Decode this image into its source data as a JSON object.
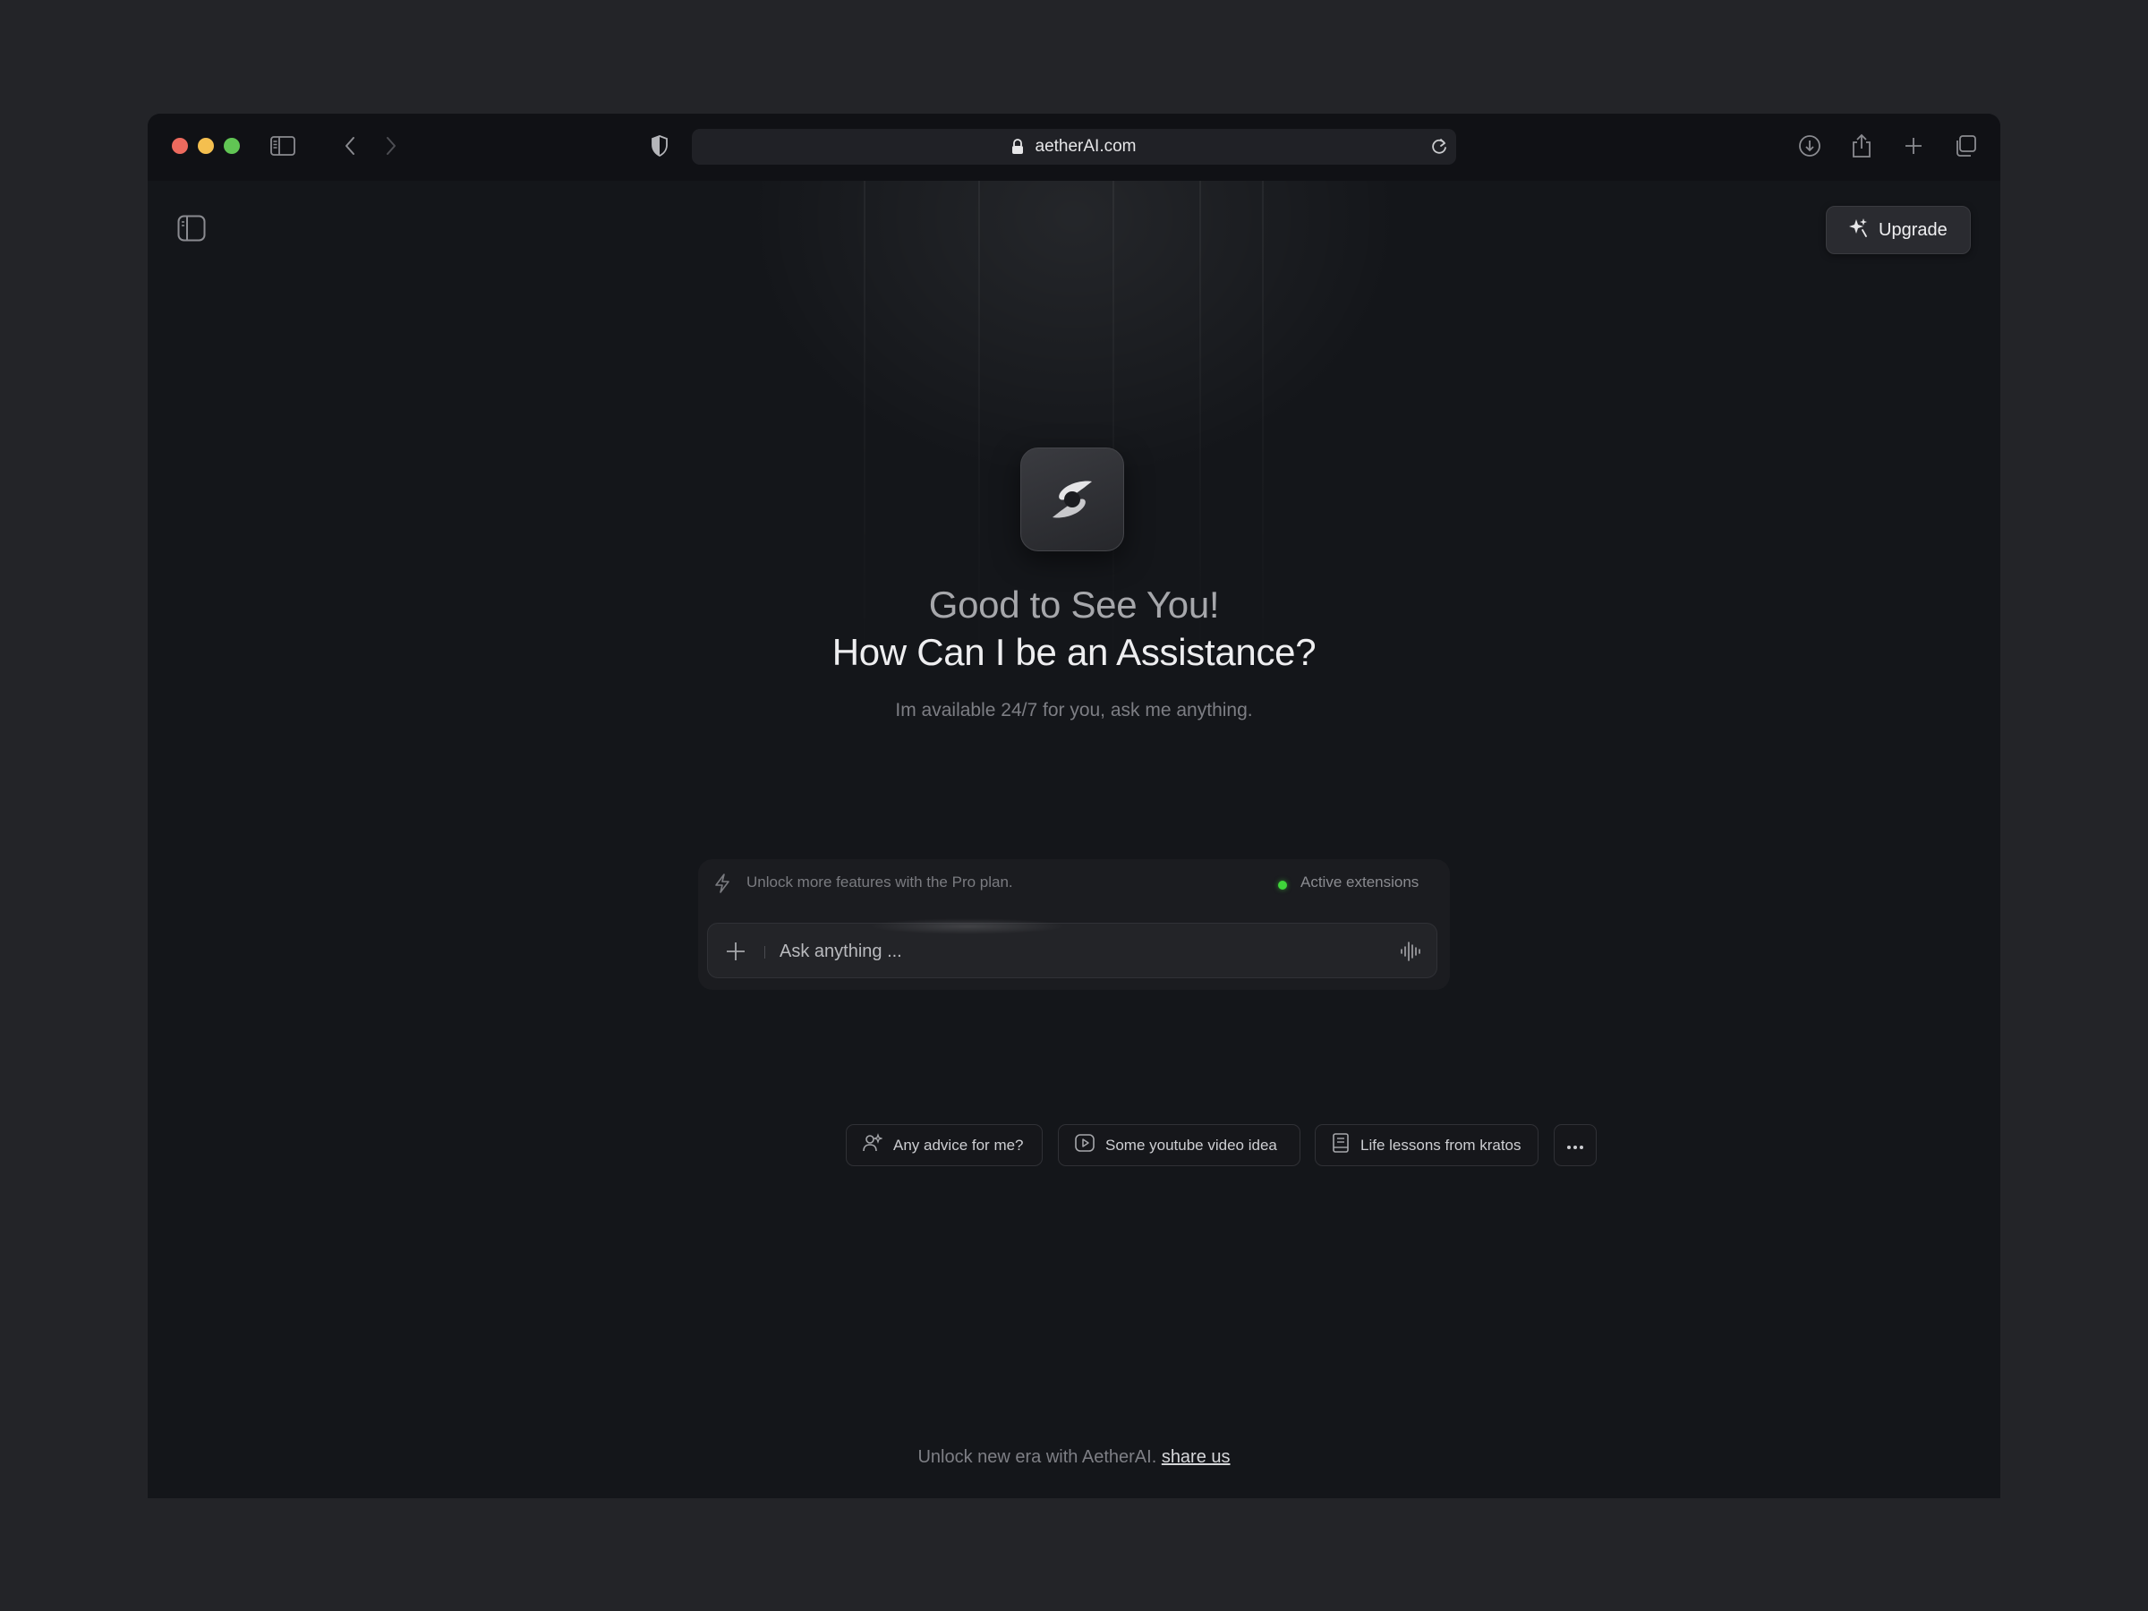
{
  "browser": {
    "url": "aetherAI.com"
  },
  "header": {
    "upgrade_label": "Upgrade"
  },
  "hero": {
    "greeting": "Good to See You!",
    "question": "How Can I be an Assistance?",
    "subtitle": "Im available 24/7 for you, ask me anything."
  },
  "prompt": {
    "pro_notice": "Unlock more features with the Pro plan.",
    "extensions_label": "Active extensions",
    "placeholder": "Ask anything ...",
    "extensions_status_color": "#3fd43a"
  },
  "suggestions": [
    {
      "label": "Any advice for me?",
      "icon": "user-sparkle-icon"
    },
    {
      "label": "Some youtube video idea",
      "icon": "play-icon"
    },
    {
      "label": "Life lessons from kratos",
      "icon": "book-icon"
    }
  ],
  "footer": {
    "text": "Unlock new era with AetherAI.",
    "link": "share us"
  }
}
